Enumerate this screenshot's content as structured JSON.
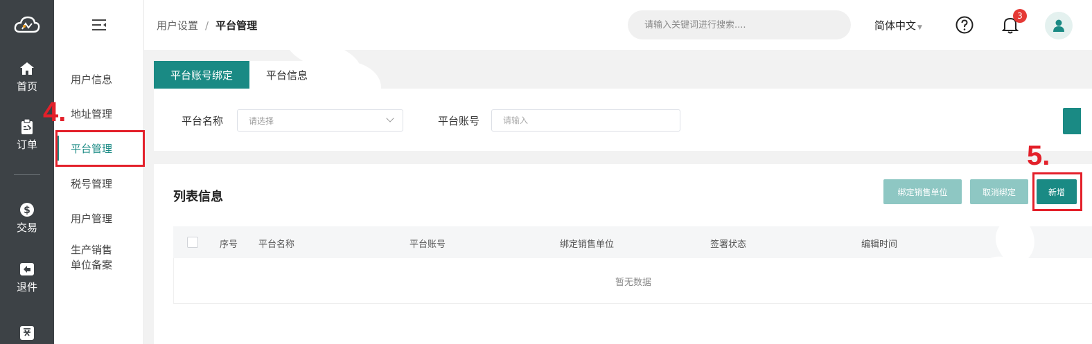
{
  "rail": {
    "items": [
      {
        "label": "首页",
        "icon": "home-icon"
      },
      {
        "label": "订单",
        "icon": "clipboard-icon"
      },
      {
        "label": "交易",
        "icon": "dollar-icon"
      },
      {
        "label": "退件",
        "icon": "return-icon"
      },
      {
        "label": "",
        "icon": "invoice-icon"
      }
    ]
  },
  "submenu": {
    "items": [
      {
        "label": "用户信息"
      },
      {
        "label": "地址管理"
      },
      {
        "label": "平台管理",
        "active": true
      },
      {
        "label": "税号管理"
      },
      {
        "label": "用户管理"
      },
      {
        "label_line1": "生产销售",
        "label_line2": "单位备案"
      }
    ]
  },
  "header": {
    "breadcrumb": [
      "用户设置",
      "平台管理"
    ],
    "breadcrumb_sep": "/",
    "search_placeholder": "请输入关键词进行搜索....",
    "language": "简体中文",
    "notification_count": "3"
  },
  "tabs": [
    {
      "label": "平台账号绑定",
      "active": true
    },
    {
      "label": "平台信息"
    }
  ],
  "filter": {
    "platform_name_label": "平台名称",
    "platform_name_placeholder": "请选择",
    "platform_account_label": "平台账号",
    "platform_account_placeholder": "请输入"
  },
  "list": {
    "title": "列表信息",
    "buttons": {
      "bind_sales_unit": "绑定销售单位",
      "unbind": "取消绑定",
      "add": "新增"
    },
    "columns": [
      "序号",
      "平台名称",
      "平台账号",
      "绑定销售单位",
      "签署状态",
      "编辑时间"
    ],
    "empty_text": "暂无数据"
  },
  "annotations": {
    "step4": "4.",
    "step5": "5."
  },
  "colors": {
    "accent": "#1a8a84",
    "accent_light": "#8ec7c3",
    "rail_bg": "#3d4246",
    "annotation": "#e3202a",
    "badge": "#e53935"
  }
}
